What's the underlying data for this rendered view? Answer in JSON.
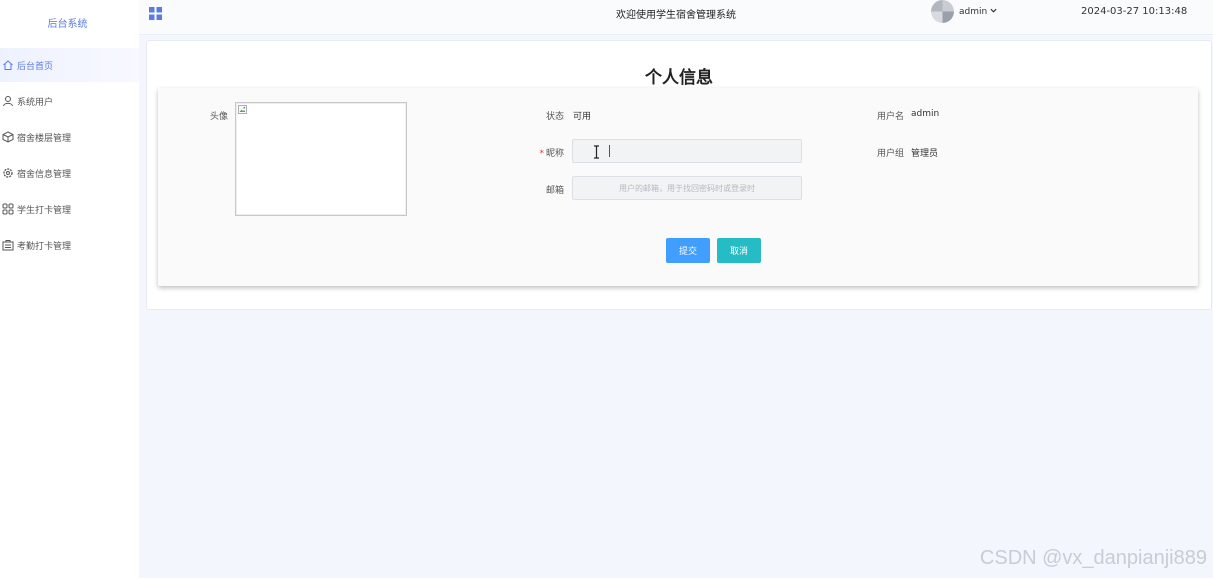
{
  "sidebar": {
    "logo": "后台系统",
    "items": [
      {
        "label": "后台首页",
        "icon": "home-icon",
        "active": true
      },
      {
        "label": "系统用户",
        "icon": "user-icon",
        "active": false
      },
      {
        "label": "宿舍楼层管理",
        "icon": "cube-icon",
        "active": false
      },
      {
        "label": "宿舍信息管理",
        "icon": "gear-icon",
        "active": false
      },
      {
        "label": "学生打卡管理",
        "icon": "apps-icon",
        "active": false
      },
      {
        "label": "考勤打卡管理",
        "icon": "clipboard-icon",
        "active": false
      }
    ]
  },
  "header": {
    "welcome": "欢迎使用学生宿舍管理系统",
    "username": "admin",
    "datetime": "2024-03-27 10:13:48"
  },
  "main": {
    "title": "个人信息",
    "form": {
      "avatar_label": "头像",
      "status_label": "状态",
      "status_value": "可用",
      "username_label": "用户名",
      "username_value": "admin",
      "nickname_label": "昵称",
      "nickname_value": "",
      "usergroup_label": "用户组",
      "usergroup_value": "管理员",
      "email_label": "邮箱",
      "email_placeholder": "用户的邮箱，用于找回密码时或登录时",
      "submit_label": "提交",
      "cancel_label": "取消"
    }
  },
  "colors": {
    "accent": "#5a7be0",
    "submit": "#409eff",
    "cancel": "#26bcc6"
  },
  "watermark": "CSDN @vx_danpianji889"
}
